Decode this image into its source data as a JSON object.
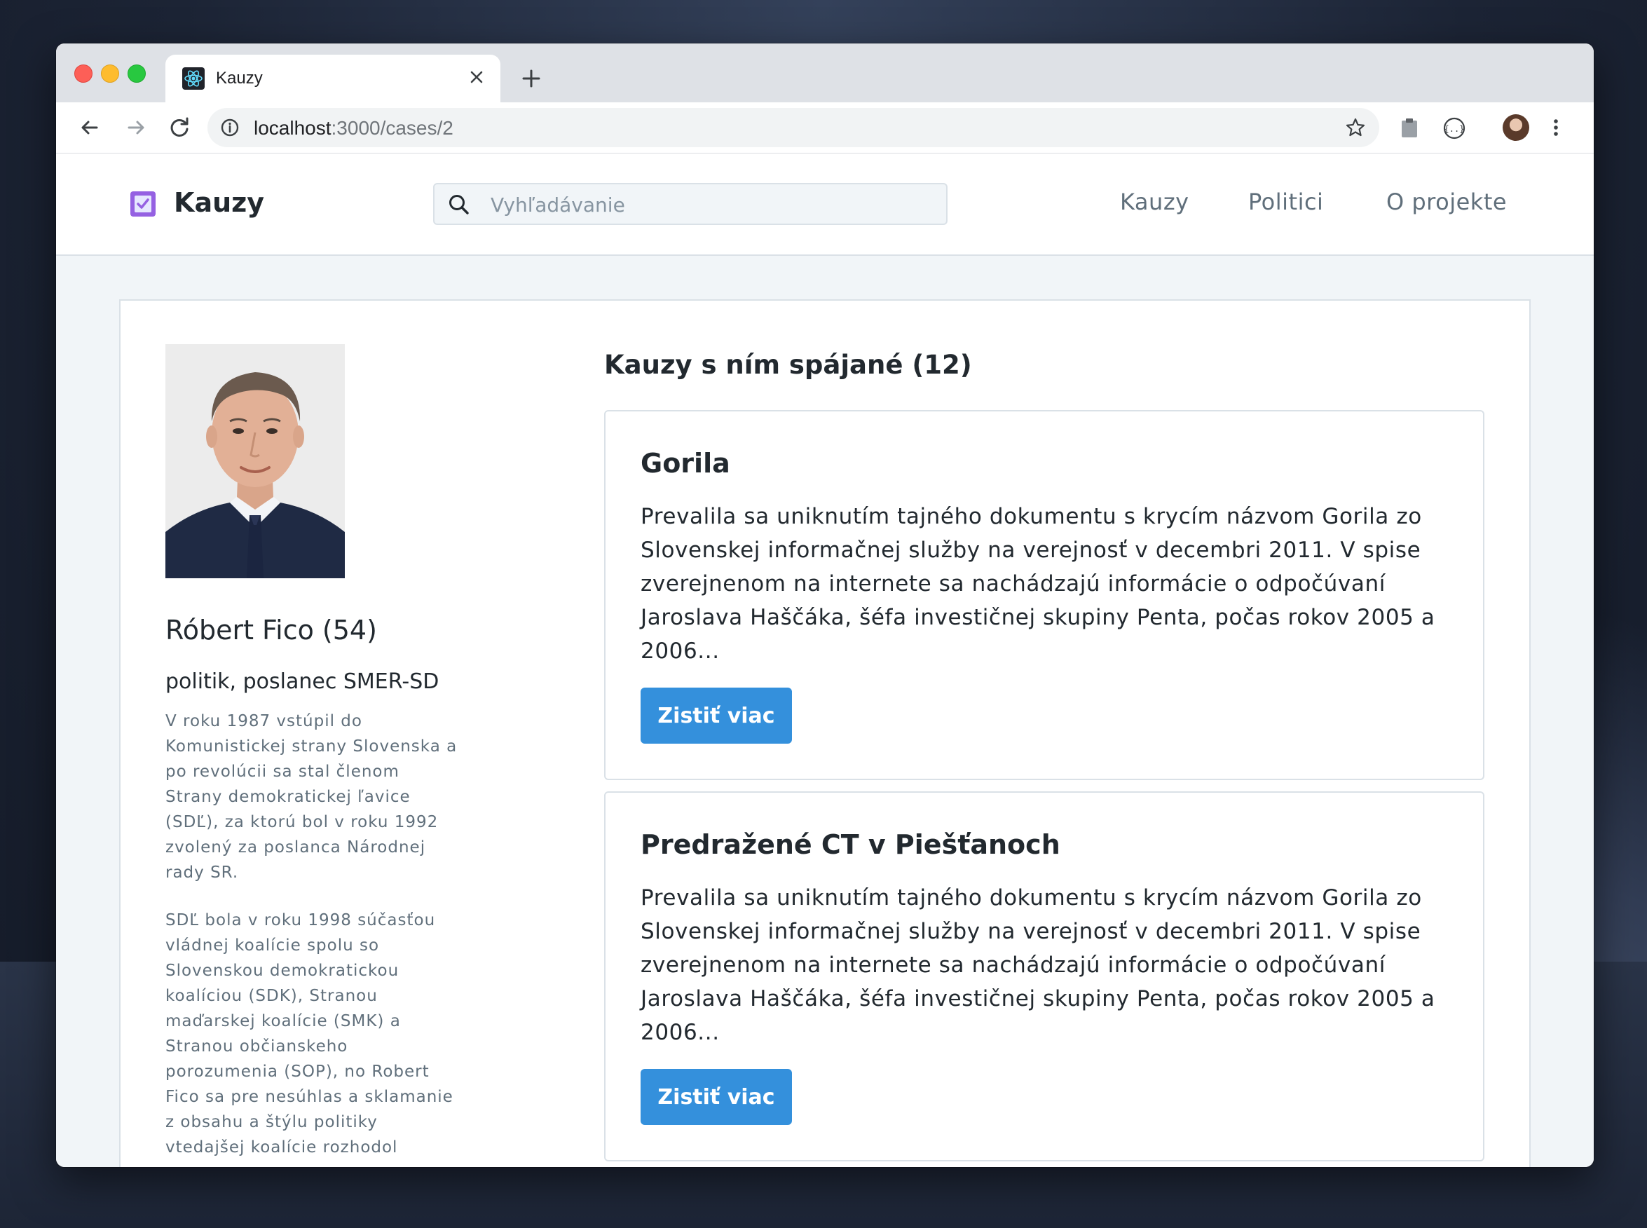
{
  "browser": {
    "tab_title": "Kauzy",
    "url_host": "localhost",
    "url_path": ":3000/cases/2"
  },
  "app": {
    "logo_text": "Kauzy",
    "search_placeholder": "Vyhľadávanie",
    "nav": [
      "Kauzy",
      "Politici",
      "O projekte"
    ],
    "accent_color": "#3490dc",
    "logo_color": "#9561e2"
  },
  "person": {
    "name_age": "Róbert Fico (54)",
    "role": "politik, poslanec SMER-SD",
    "bio": [
      "V roku 1987 vstúpil do Komunistickej strany Slovenska a po revolúcii sa stal členom Strany demokratickej ľavice (SDĽ), za ktorú bol v roku 1992 zvolený za poslanca Národnej rady SR.",
      "SDĽ bola v roku 1998 súčasťou vládnej koalície spolu so Slovenskou demokratickou koalíciou (SDK), Stranou maďarskej koalície (SMK) a Stranou občianskeho porozumenia (SOP), no Robert Fico sa pre nesúhlas a sklamanie z obsahu a štýlu politiky vtedajšej koalície rozhodol"
    ]
  },
  "cases": {
    "heading": "Kauzy s ním spájané (12)",
    "items": [
      {
        "title": "Gorila",
        "description": "Prevalila sa uniknutím tajného dokumentu s krycím názvom Gorila zo Slovenskej informačnej služby na verejnosť v decembri 2011. V spise zverejnenom na internete sa nachádzajú informácie o odpočúvaní Jaroslava Haščáka, šéfa investičnej skupiny Penta, počas rokov 2005 a 2006...",
        "button": "Zistiť viac"
      },
      {
        "title": "Predražené CT v Piešťanoch",
        "description": "Prevalila sa uniknutím tajného dokumentu s krycím názvom Gorila zo Slovenskej informačnej služby na verejnosť v decembri 2011. V spise zverejnenom na internete sa nachádzajú informácie o odpočúvaní Jaroslava Haščáka, šéfa investičnej skupiny Penta, počas rokov 2005 a 2006...",
        "button": "Zistiť viac"
      }
    ]
  },
  "icons": {
    "tab_favicon": "react-atom-icon",
    "back": "arrow-left-icon",
    "forward": "arrow-right-icon",
    "reload": "reload-icon",
    "info": "info-icon",
    "bookmark": "star-icon",
    "logo": "checkbox-icon",
    "search": "search-icon"
  }
}
